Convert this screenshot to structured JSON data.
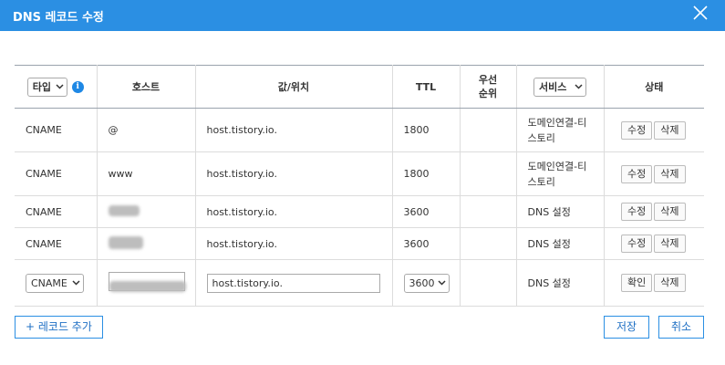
{
  "window": {
    "title": "DNS 레코드 수정"
  },
  "header": {
    "type_select": "타입",
    "host": "호스트",
    "value": "값/위치",
    "ttl": "TTL",
    "priority": "우선\n순위",
    "service_select": "서비스",
    "status": "상태"
  },
  "rows": [
    {
      "type": "CNAME",
      "host": "@",
      "value": "host.tistory.io.",
      "ttl": "1800",
      "priority": "",
      "service": "도메인연결-티\n스토리",
      "btn1": "수정",
      "btn2": "삭제"
    },
    {
      "type": "CNAME",
      "host": "www",
      "value": "host.tistory.io.",
      "ttl": "1800",
      "priority": "",
      "service": "도메인연결-티\n스토리",
      "btn1": "수정",
      "btn2": "삭제"
    },
    {
      "type": "CNAME",
      "host": "",
      "value": "host.tistory.io.",
      "ttl": "3600",
      "priority": "",
      "service": "DNS 설정",
      "btn1": "수정",
      "btn2": "삭제"
    },
    {
      "type": "CNAME",
      "host": "",
      "value": "host.tistory.io.",
      "ttl": "3600",
      "priority": "",
      "service": "DNS 설정",
      "btn1": "수정",
      "btn2": "삭제"
    }
  ],
  "edit_row": {
    "type": "CNAME",
    "host": "",
    "value": "host.tistory.io.",
    "ttl": "3600",
    "service": "DNS 설정",
    "btn1": "확인",
    "btn2": "삭제"
  },
  "footer": {
    "add": "+ 레코드 추가",
    "save": "저장",
    "cancel": "취소"
  },
  "colors": {
    "titlebar": "#2b8fe3",
    "accent": "#1e88e5"
  }
}
